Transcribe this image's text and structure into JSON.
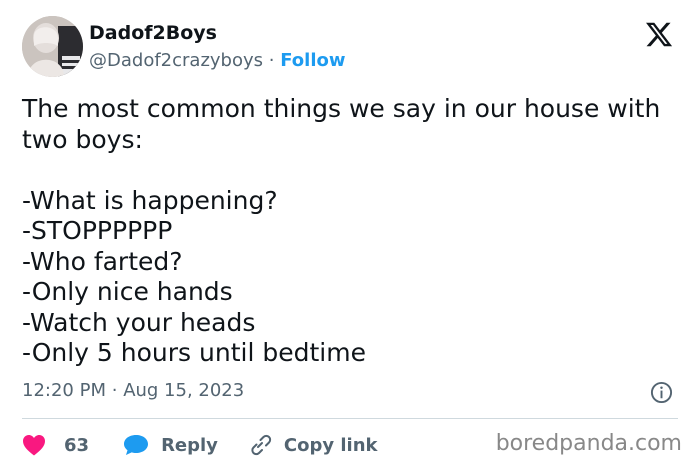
{
  "user": {
    "display_name": "Dadof2Boys",
    "handle": "@Dadof2crazyboys",
    "separator": "·",
    "follow_label": "Follow"
  },
  "tweet": {
    "intro": "The most common things we say in our house with two boys:",
    "lines": [
      "-What is happening?",
      "-STOPPPPPP",
      "-Who farted?",
      "-Only nice hands",
      "-Watch your heads",
      "-Only 5 hours until bedtime"
    ],
    "time": "12:20 PM",
    "separator": "·",
    "date": "Aug 15, 2023"
  },
  "actions": {
    "like_count": "63",
    "reply_label": "Reply",
    "copy_link_label": "Copy link"
  },
  "watermark": "boredpanda.com",
  "colors": {
    "text": "#0f1419",
    "secondary": "#536471",
    "accent": "#1d9bf0",
    "like": "#f91880",
    "divider": "#cfd9de"
  },
  "icons": [
    "x-logo-icon",
    "info-icon",
    "heart-icon",
    "reply-bubble-icon",
    "link-icon"
  ]
}
